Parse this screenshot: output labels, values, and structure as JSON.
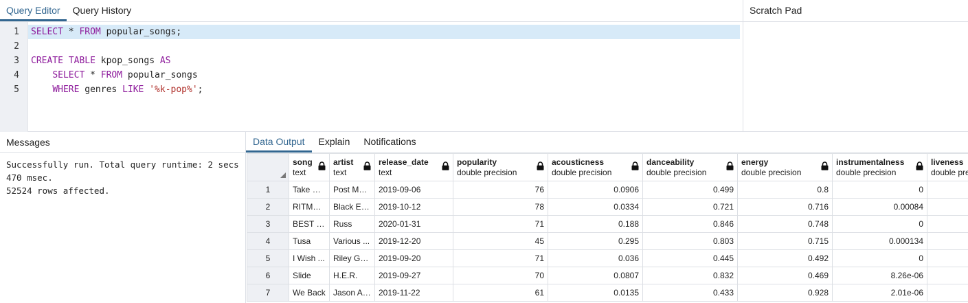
{
  "editor": {
    "tabs": [
      {
        "label": "Query Editor",
        "active": true
      },
      {
        "label": "Query History",
        "active": false
      }
    ],
    "line_numbers": [
      "1",
      "2",
      "3",
      "4",
      "5"
    ],
    "lines": [
      [
        {
          "t": "SELECT",
          "k": "kw"
        },
        {
          "t": " * ",
          "k": ""
        },
        {
          "t": "FROM",
          "k": "kw"
        },
        {
          "t": " popular_songs;",
          "k": ""
        }
      ],
      [],
      [
        {
          "t": "CREATE TABLE",
          "k": "kw"
        },
        {
          "t": " kpop_songs ",
          "k": ""
        },
        {
          "t": "AS",
          "k": "kw"
        }
      ],
      [
        {
          "t": "    ",
          "k": ""
        },
        {
          "t": "SELECT",
          "k": "kw"
        },
        {
          "t": " * ",
          "k": ""
        },
        {
          "t": "FROM",
          "k": "kw"
        },
        {
          "t": " popular_songs",
          "k": ""
        }
      ],
      [
        {
          "t": "    ",
          "k": ""
        },
        {
          "t": "WHERE",
          "k": "kw"
        },
        {
          "t": " genres ",
          "k": ""
        },
        {
          "t": "LIKE",
          "k": "kw"
        },
        {
          "t": " ",
          "k": ""
        },
        {
          "t": "'%k-pop%'",
          "k": "str"
        },
        {
          "t": ";",
          "k": ""
        }
      ]
    ],
    "highlighted_line": 0
  },
  "scratch_pad": {
    "title": "Scratch Pad"
  },
  "messages": {
    "tab_label": "Messages",
    "text": "Successfully run. Total query runtime: 2 secs 470 msec.\n52524 rows affected."
  },
  "output": {
    "tabs": [
      {
        "label": "Data Output",
        "active": true
      },
      {
        "label": "Explain",
        "active": false
      },
      {
        "label": "Notifications",
        "active": false
      }
    ],
    "columns": [
      {
        "name": "song",
        "type": "text",
        "align": "txt"
      },
      {
        "name": "artist",
        "type": "text",
        "align": "txt"
      },
      {
        "name": "release_date",
        "type": "text",
        "align": "txt"
      },
      {
        "name": "popularity",
        "type": "double precision",
        "align": "num"
      },
      {
        "name": "acousticness",
        "type": "double precision",
        "align": "num"
      },
      {
        "name": "danceability",
        "type": "double precision",
        "align": "num"
      },
      {
        "name": "energy",
        "type": "double precision",
        "align": "num"
      },
      {
        "name": "instrumentalness",
        "type": "double precision",
        "align": "num"
      },
      {
        "name": "liveness",
        "type": "double precision",
        "align": "num"
      }
    ],
    "rows": [
      {
        "n": "1",
        "cells": [
          "Take W...",
          "Post Mal...",
          "2019-09-06",
          "76",
          "0.0906",
          "0.499",
          "0.8",
          "0",
          ""
        ]
      },
      {
        "n": "2",
        "cells": [
          "RITMO ...",
          "Black Ey...",
          "2019-10-12",
          "78",
          "0.0334",
          "0.721",
          "0.716",
          "0.00084",
          ""
        ]
      },
      {
        "n": "3",
        "cells": [
          "BEST O...",
          "Russ",
          "2020-01-31",
          "71",
          "0.188",
          "0.846",
          "0.748",
          "0",
          ""
        ]
      },
      {
        "n": "4",
        "cells": [
          "Tusa",
          "Various ...",
          "2019-12-20",
          "45",
          "0.295",
          "0.803",
          "0.715",
          "0.000134",
          ""
        ]
      },
      {
        "n": "5",
        "cells": [
          "I Wish ...",
          "Riley Gre...",
          "2019-09-20",
          "71",
          "0.036",
          "0.445",
          "0.492",
          "0",
          ""
        ]
      },
      {
        "n": "6",
        "cells": [
          "Slide",
          "H.E.R.",
          "2019-09-27",
          "70",
          "0.0807",
          "0.832",
          "0.469",
          "8.26e-06",
          ""
        ]
      },
      {
        "n": "7",
        "cells": [
          "We Back",
          "Jason Al...",
          "2019-11-22",
          "61",
          "0.0135",
          "0.433",
          "0.928",
          "2.01e-06",
          ""
        ]
      }
    ]
  },
  "colors": {
    "accent": "#326690",
    "keyword": "#8e1c9c",
    "string": "#b0302b",
    "line_highlight": "#d7eaf8",
    "gutter": "#eef0f4"
  }
}
